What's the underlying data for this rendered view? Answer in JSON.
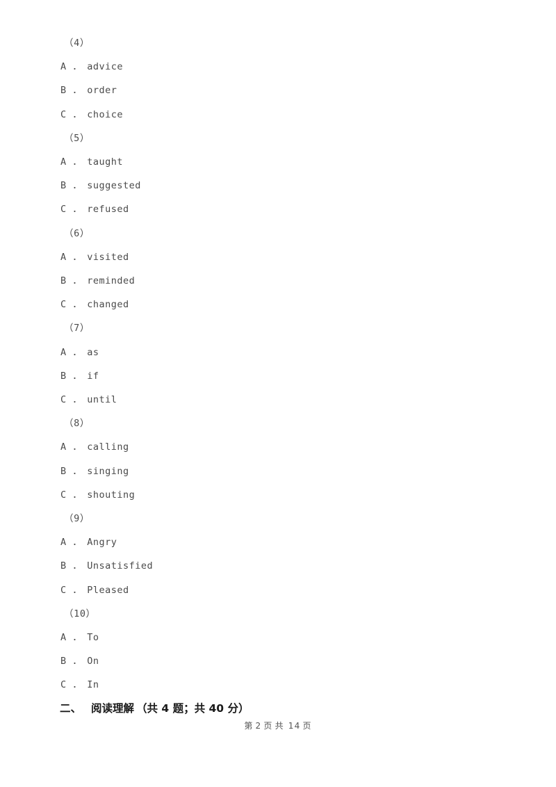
{
  "document": {
    "type": "exam-paper",
    "text_color": "#4a4a4a",
    "heading_color": "#1a1a1a",
    "background_color": "#ffffff"
  },
  "questions": [
    {
      "number": "（4）",
      "options": [
        {
          "label": "A ．",
          "text": "advice"
        },
        {
          "label": "B ．",
          "text": "order"
        },
        {
          "label": "C ．",
          "text": "choice"
        }
      ]
    },
    {
      "number": "（5）",
      "options": [
        {
          "label": "A ．",
          "text": "taught"
        },
        {
          "label": "B ．",
          "text": "suggested"
        },
        {
          "label": "C ．",
          "text": "refused"
        }
      ]
    },
    {
      "number": "（6）",
      "options": [
        {
          "label": "A ．",
          "text": "visited"
        },
        {
          "label": "B ．",
          "text": "reminded"
        },
        {
          "label": "C ．",
          "text": "changed"
        }
      ]
    },
    {
      "number": "（7）",
      "options": [
        {
          "label": "A ．",
          "text": "as"
        },
        {
          "label": "B ．",
          "text": "if"
        },
        {
          "label": "C ．",
          "text": "until"
        }
      ]
    },
    {
      "number": "（8）",
      "options": [
        {
          "label": "A ．",
          "text": "calling"
        },
        {
          "label": "B ．",
          "text": "singing"
        },
        {
          "label": "C ．",
          "text": "shouting"
        }
      ]
    },
    {
      "number": "（9）",
      "options": [
        {
          "label": "A ．",
          "text": "Angry"
        },
        {
          "label": "B ．",
          "text": "Unsatisfied"
        },
        {
          "label": "C ．",
          "text": "Pleased"
        }
      ]
    },
    {
      "number": "（10）",
      "options": [
        {
          "label": "A ．",
          "text": "To"
        },
        {
          "label": "B ．",
          "text": "On"
        },
        {
          "label": "C ．",
          "text": "In"
        }
      ]
    }
  ],
  "section_heading": {
    "marker": "二、",
    "title": "阅读理解",
    "meta": "（共 4 题；共 40 分）"
  },
  "footer": {
    "prefix": "第",
    "current_page": "2",
    "page_unit": "页",
    "middle": "共",
    "total_pages": "14",
    "page_unit_2": "页"
  }
}
